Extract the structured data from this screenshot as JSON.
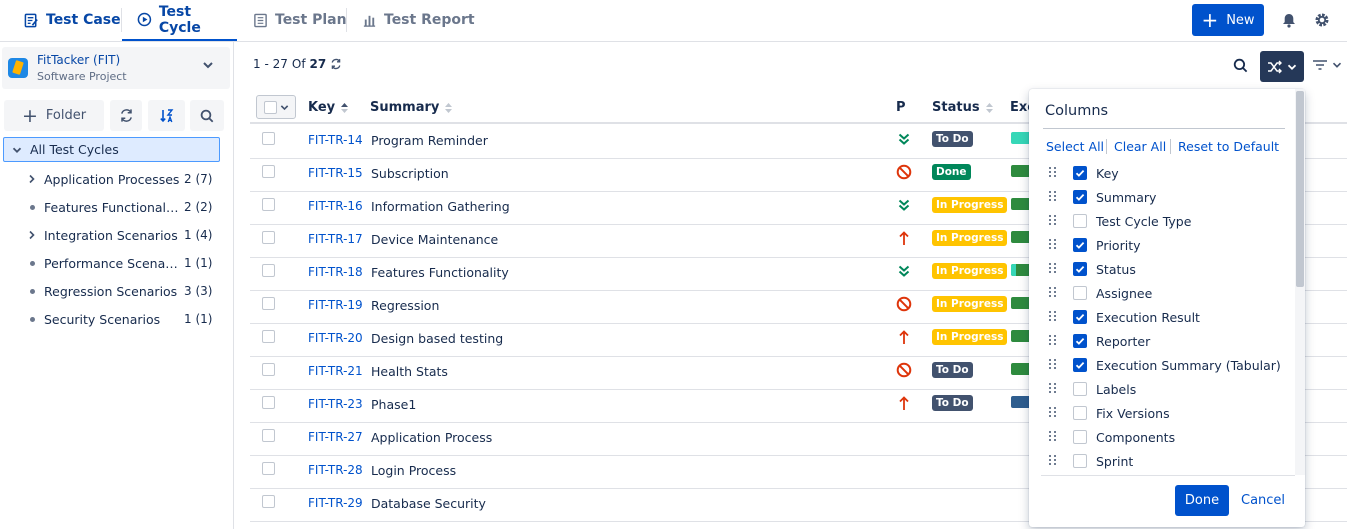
{
  "tabs": [
    {
      "label": "Test Case",
      "active": true
    },
    {
      "label": "Test Cycle",
      "active": true
    },
    {
      "label": "Test Plan",
      "active": false
    },
    {
      "label": "Test Report",
      "active": false
    }
  ],
  "header": {
    "new_label": "New",
    "icons": [
      "bell-icon",
      "gear-icon"
    ]
  },
  "project": {
    "name": "FitTacker (FIT)",
    "type": "Software Project"
  },
  "sidebar": {
    "folder_label": "Folder",
    "root_label": "All Test Cycles",
    "items": [
      {
        "label": "Application Processes",
        "count": "2 (7)",
        "expandable": true
      },
      {
        "label": "Features Functionality",
        "count": "2 (2)",
        "expandable": false
      },
      {
        "label": "Integration Scenarios",
        "count": "1 (4)",
        "expandable": true
      },
      {
        "label": "Performance Scenarios",
        "count": "1 (1)",
        "expandable": false
      },
      {
        "label": "Regression Scenarios",
        "count": "3 (3)",
        "expandable": false
      },
      {
        "label": "Security Scenarios",
        "count": "1 (1)",
        "expandable": false
      }
    ]
  },
  "pager": {
    "range": "1 - 27",
    "of": "Of",
    "total": "27"
  },
  "table": {
    "headers": {
      "key": "Key",
      "summary": "Summary",
      "priority": "P",
      "status": "Status",
      "execution": "Exe"
    },
    "rows": [
      {
        "key": "FIT-TR-14",
        "summary": "Program Reminder",
        "priority": "lowest",
        "status": "To Do",
        "exec": "teal"
      },
      {
        "key": "FIT-TR-15",
        "summary": "Subscription",
        "priority": "blocker",
        "status": "Done",
        "exec": "green"
      },
      {
        "key": "FIT-TR-16",
        "summary": "Information Gathering",
        "priority": "lowest",
        "status": "In Progress",
        "exec": "green"
      },
      {
        "key": "FIT-TR-17",
        "summary": "Device Maintenance",
        "priority": "highest",
        "status": "In Progress",
        "exec": "green"
      },
      {
        "key": "FIT-TR-18",
        "summary": "Features Functionality",
        "priority": "lowest",
        "status": "In Progress",
        "exec": "mixed"
      },
      {
        "key": "FIT-TR-19",
        "summary": "Regression",
        "priority": "blocker",
        "status": "In Progress",
        "exec": "green"
      },
      {
        "key": "FIT-TR-20",
        "summary": "Design based testing",
        "priority": "highest",
        "status": "In Progress",
        "exec": "green"
      },
      {
        "key": "FIT-TR-21",
        "summary": "Health Stats",
        "priority": "blocker",
        "status": "To Do",
        "exec": "green"
      },
      {
        "key": "FIT-TR-23",
        "summary": "Phase1",
        "priority": "highest",
        "status": "To Do",
        "exec": "blue"
      },
      {
        "key": "FIT-TR-27",
        "summary": "Application Process",
        "priority": "",
        "status": "",
        "exec": ""
      },
      {
        "key": "FIT-TR-28",
        "summary": "Login Process",
        "priority": "",
        "status": "",
        "exec": ""
      },
      {
        "key": "FIT-TR-29",
        "summary": "Database Security",
        "priority": "",
        "status": "",
        "exec": ""
      }
    ]
  },
  "columns_panel": {
    "title": "Columns",
    "select_all": "Select All",
    "clear_all": "Clear All",
    "reset": "Reset to Default",
    "items": [
      {
        "label": "Key",
        "checked": true
      },
      {
        "label": "Summary",
        "checked": true
      },
      {
        "label": "Test Cycle Type",
        "checked": false
      },
      {
        "label": "Priority",
        "checked": true
      },
      {
        "label": "Status",
        "checked": true
      },
      {
        "label": "Assignee",
        "checked": false
      },
      {
        "label": "Execution Result",
        "checked": true
      },
      {
        "label": "Reporter",
        "checked": true
      },
      {
        "label": "Execution Summary (Tabular)",
        "checked": true
      },
      {
        "label": "Labels",
        "checked": false
      },
      {
        "label": "Fix Versions",
        "checked": false
      },
      {
        "label": "Components",
        "checked": false
      },
      {
        "label": "Sprint",
        "checked": false
      }
    ],
    "done": "Done",
    "cancel": "Cancel"
  },
  "colors": {
    "primary": "#0052cc",
    "todo": "#42526e",
    "done": "#00875a",
    "in_progress": "#ffc400",
    "danger": "#de350b"
  }
}
